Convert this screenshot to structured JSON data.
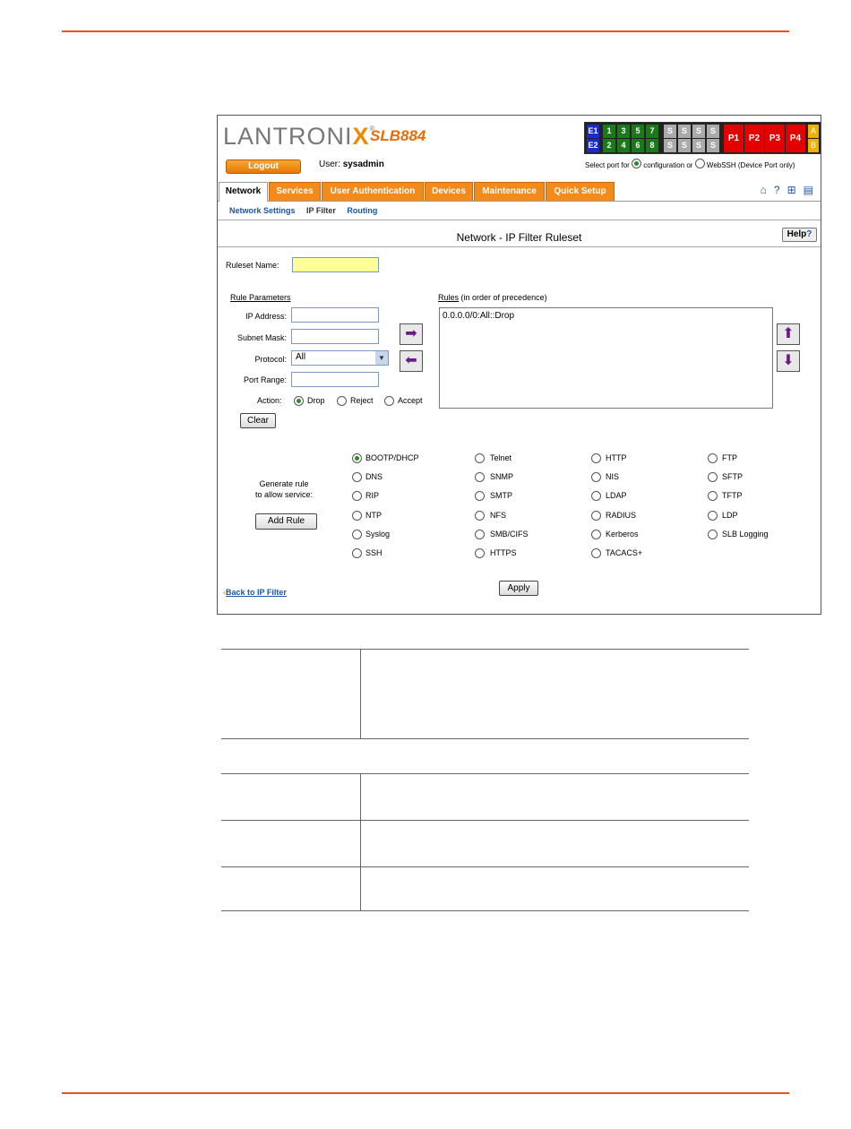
{
  "app": {
    "brand": "LANTRONIX",
    "brand_reg": "®",
    "model": "SLB884",
    "logout_label": "Logout",
    "user_label": "User:",
    "user_name": "sysadmin",
    "port_select_prefix": "Select port for",
    "port_select_opt1": "configuration or",
    "port_select_opt2": "WebSSH (Device Port only)",
    "ports": {
      "e": [
        "E1",
        "E2"
      ],
      "green_top": [
        "1",
        "3",
        "5",
        "7"
      ],
      "green_bottom": [
        "2",
        "4",
        "6",
        "8"
      ],
      "s": [
        "S",
        "S",
        "S",
        "S",
        "S",
        "S",
        "S",
        "S"
      ],
      "p": [
        "P1",
        "P2",
        "P3",
        "P4"
      ],
      "ab": [
        "A",
        "B"
      ]
    },
    "colors": {
      "accent": "#f28a1c",
      "port_green": "#1a7a1a",
      "port_blue": "#1a2ad0",
      "port_red": "#e40000",
      "port_grey": "#aaaaaa",
      "port_amber": "#f0b000"
    }
  },
  "tabs": [
    "Network",
    "Services",
    "User Authentication",
    "Devices",
    "Maintenance",
    "Quick Setup"
  ],
  "subnav": [
    "Network Settings",
    "IP Filter",
    "Routing"
  ],
  "page": {
    "title": "Network - IP Filter Ruleset",
    "help_label": "Help",
    "ruleset_name_label": "Ruleset Name:",
    "ruleset_name_value": "",
    "rule_params_header": "Rule Parameters",
    "ip_label": "IP Address:",
    "mask_label": "Subnet Mask:",
    "protocol_label": "Protocol:",
    "protocol_value": "All",
    "port_range_label": "Port Range:",
    "action_label": "Action:",
    "actions": [
      "Drop",
      "Reject",
      "Accept"
    ],
    "action_selected": "Drop",
    "clear_label": "Clear",
    "rules_header": "Rules",
    "rules_header_note": "(in order of precedence)",
    "rules": [
      "0.0.0.0/0:All::Drop"
    ],
    "generate_label_1": "Generate rule",
    "generate_label_2": "to allow service:",
    "add_rule_label": "Add Rule",
    "services": [
      [
        "BOOTP/DHCP",
        "Telnet",
        "HTTP",
        "FTP"
      ],
      [
        "DNS",
        "SNMP",
        "NIS",
        "SFTP"
      ],
      [
        "RIP",
        "SMTP",
        "LDAP",
        "TFTP"
      ],
      [
        "NTP",
        "NFS",
        "RADIUS",
        "LDP"
      ],
      [
        "Syslog",
        "SMB/CIFS",
        "Kerberos",
        "SLB Logging"
      ],
      [
        "SSH",
        "HTTPS",
        "TACACS+",
        ""
      ]
    ],
    "service_selected": "BOOTP/DHCP",
    "back_link": "Back to IP Filter",
    "apply_label": "Apply"
  }
}
